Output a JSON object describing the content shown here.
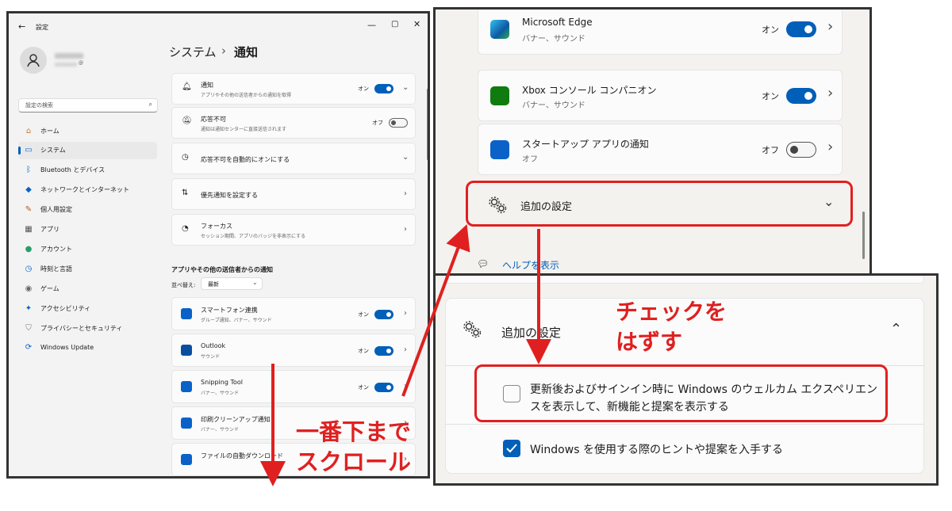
{
  "window": {
    "title": "設定",
    "user_email_suffix": "@",
    "search_placeholder": "設定の検索",
    "breadcrumb_parent": "システム",
    "breadcrumb_sep": "›",
    "breadcrumb_current": "通知",
    "nav": [
      {
        "label": "ホーム",
        "icon": "home-icon"
      },
      {
        "label": "システム",
        "icon": "system-icon"
      },
      {
        "label": "Bluetooth とデバイス",
        "icon": "bluetooth-icon"
      },
      {
        "label": "ネットワークとインターネット",
        "icon": "wifi-icon"
      },
      {
        "label": "個人用設定",
        "icon": "brush-icon"
      },
      {
        "label": "アプリ",
        "icon": "apps-icon"
      },
      {
        "label": "アカウント",
        "icon": "account-icon"
      },
      {
        "label": "時刻と言語",
        "icon": "clock-icon"
      },
      {
        "label": "ゲーム",
        "icon": "gamepad-icon"
      },
      {
        "label": "アクセシビリティ",
        "icon": "accessibility-icon"
      },
      {
        "label": "プライバシーとセキュリティ",
        "icon": "shield-icon"
      },
      {
        "label": "Windows Update",
        "icon": "update-icon"
      }
    ],
    "notifications": {
      "title": "通知",
      "sub": "アプリやその他の送信者からの通知を取得",
      "state": "オン"
    },
    "dnd": {
      "title": "応答不可",
      "sub": "通知は通知センターに直接送信されます",
      "state": "オフ"
    },
    "auto_dnd": {
      "title": "応答不可を自動的にオンにする"
    },
    "priority": {
      "title": "優先通知を設定する"
    },
    "focus": {
      "title": "フォーカス",
      "sub": "セッション期間、アプリのバッジを非表示にする"
    },
    "apps_heading": "アプリやその他の送信者からの通知",
    "sort_label": "並べ替え:",
    "sort_value": "最新",
    "apps": [
      {
        "title": "スマートフォン連携",
        "sub": "グループ通知、バナー、サウンド",
        "state": "オン"
      },
      {
        "title": "Outlook",
        "sub": "サウンド",
        "state": "オン"
      },
      {
        "title": "Snipping Tool",
        "sub": "バナー、サウンド",
        "state": "オン"
      },
      {
        "title": "印刷クリーンアップ通知",
        "sub": "バナー、サウンド",
        "state": ""
      },
      {
        "title": "ファイルの自動ダウンロード",
        "sub": "",
        "state": ""
      }
    ]
  },
  "zoom1": {
    "apps": [
      {
        "title": "Microsoft Edge",
        "sub": "バナー、サウンド",
        "state": "オン"
      },
      {
        "title": "Xbox コンソール コンパニオン",
        "sub": "バナー、サウンド",
        "state": "オン"
      },
      {
        "title": "スタートアップ アプリの通知",
        "sub": "オフ",
        "state": "オフ"
      }
    ],
    "additional": "追加の設定",
    "help": "ヘルプを表示"
  },
  "zoom2": {
    "additional": "追加の設定",
    "option1_line1": "更新後およびサインイン時に Windows のウェルカム エクスペリエン",
    "option1_line2": "スを表示して、新機能と提案を表示する",
    "option2": "Windows を使用する際のヒントや提案を入手する"
  },
  "annotations": {
    "scroll_line1": "一番下まで",
    "scroll_line2": "スクロール",
    "uncheck_line1": "チェックを",
    "uncheck_line2": "はずす"
  },
  "colors": {
    "accent": "#005fb8",
    "annotation": "#e02020"
  }
}
